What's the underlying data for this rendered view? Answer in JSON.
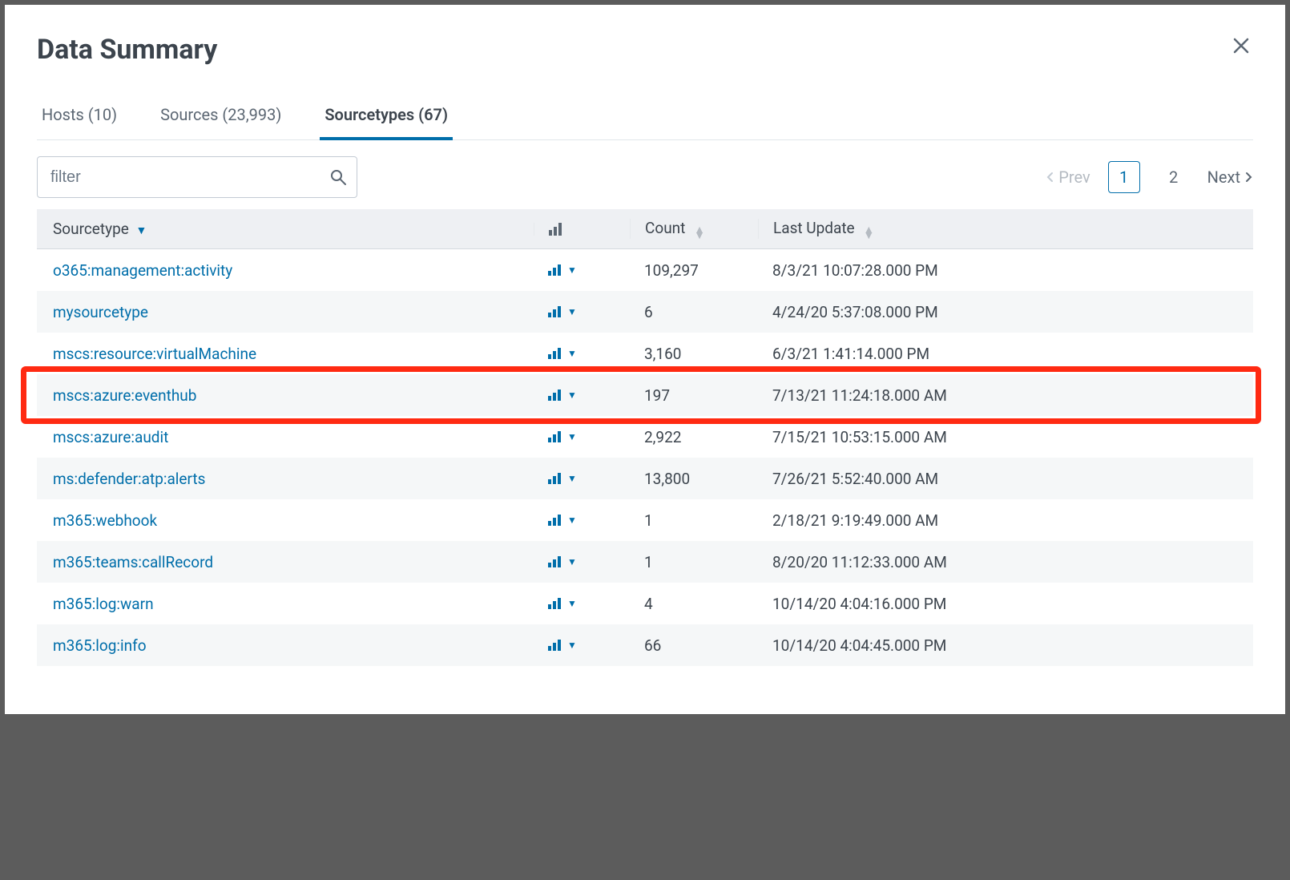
{
  "title": "Data Summary",
  "tabs": [
    {
      "label": "Hosts (10)",
      "active": false
    },
    {
      "label": "Sources (23,993)",
      "active": false
    },
    {
      "label": "Sourcetypes (67)",
      "active": true
    }
  ],
  "filter": {
    "placeholder": "filter"
  },
  "pager": {
    "prev": "Prev",
    "next": "Next",
    "pages": [
      "1",
      "2"
    ],
    "current": "1"
  },
  "columns": {
    "sourcetype": "Sourcetype",
    "count": "Count",
    "last_update": "Last Update"
  },
  "rows": [
    {
      "name": "o365:management:activity",
      "count": "109,297",
      "update": "8/3/21 10:07:28.000 PM"
    },
    {
      "name": "mysourcetype",
      "count": "6",
      "update": "4/24/20 5:37:08.000 PM"
    },
    {
      "name": "mscs:resource:virtualMachine",
      "count": "3,160",
      "update": "6/3/21 1:41:14.000 PM"
    },
    {
      "name": "mscs:azure:eventhub",
      "count": "197",
      "update": "7/13/21 11:24:18.000 AM"
    },
    {
      "name": "mscs:azure:audit",
      "count": "2,922",
      "update": "7/15/21 10:53:15.000 AM"
    },
    {
      "name": "ms:defender:atp:alerts",
      "count": "13,800",
      "update": "7/26/21 5:52:40.000 AM"
    },
    {
      "name": "m365:webhook",
      "count": "1",
      "update": "2/18/21 9:19:49.000 AM"
    },
    {
      "name": "m365:teams:callRecord",
      "count": "1",
      "update": "8/20/20 11:12:33.000 AM"
    },
    {
      "name": "m365:log:warn",
      "count": "4",
      "update": "10/14/20 4:04:16.000 PM"
    },
    {
      "name": "m365:log:info",
      "count": "66",
      "update": "10/14/20 4:04:45.000 PM"
    }
  ],
  "highlight_index": 3
}
